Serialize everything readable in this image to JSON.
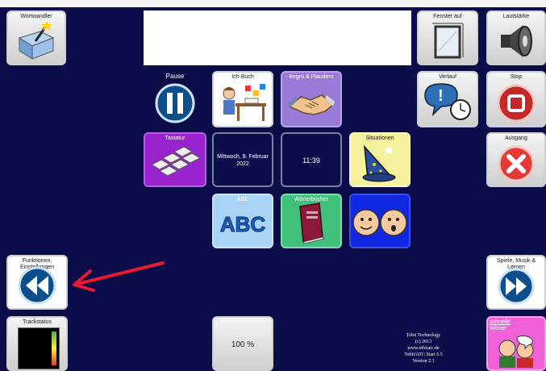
{
  "tiles": {
    "wortwandler": "Wortwandler",
    "fenster_auf": "Fenster auf",
    "lautstarke": "Lautstärke",
    "pause": "Pause",
    "ich_buch": "Ich-Buch",
    "begrussen": "Begrü & Plaudern",
    "verlauf": "Verlauf",
    "stop": "Stop",
    "tastatur": "Tastatur",
    "datum": "Mittwoch, 9. Februar 2022",
    "uhrzeit": "11:39",
    "situationen": "Situationen",
    "ausgang": "Ausgang",
    "abc": "ABC",
    "abc_icon_text": "ABC",
    "woerterbuecher": "Wörterbücher",
    "zurueck": "Funktionen, Einstellungen",
    "vor": "Spiele, Musik & Lernen",
    "trackstatus": "Trackstatus",
    "zoom": "100 %",
    "schnelle_1": "schnelle",
    "schnelle_2": "Wörter"
  },
  "footer": {
    "line1": "Tobii Technology",
    "line2": "(c) 2013",
    "line3": "www.tobiiatc.de",
    "line4": "Tobii/ATC Start 6.5",
    "line5": "Version 2.1"
  },
  "colors": {
    "background": "#0b0d4a",
    "arrow": "#e8182e"
  }
}
